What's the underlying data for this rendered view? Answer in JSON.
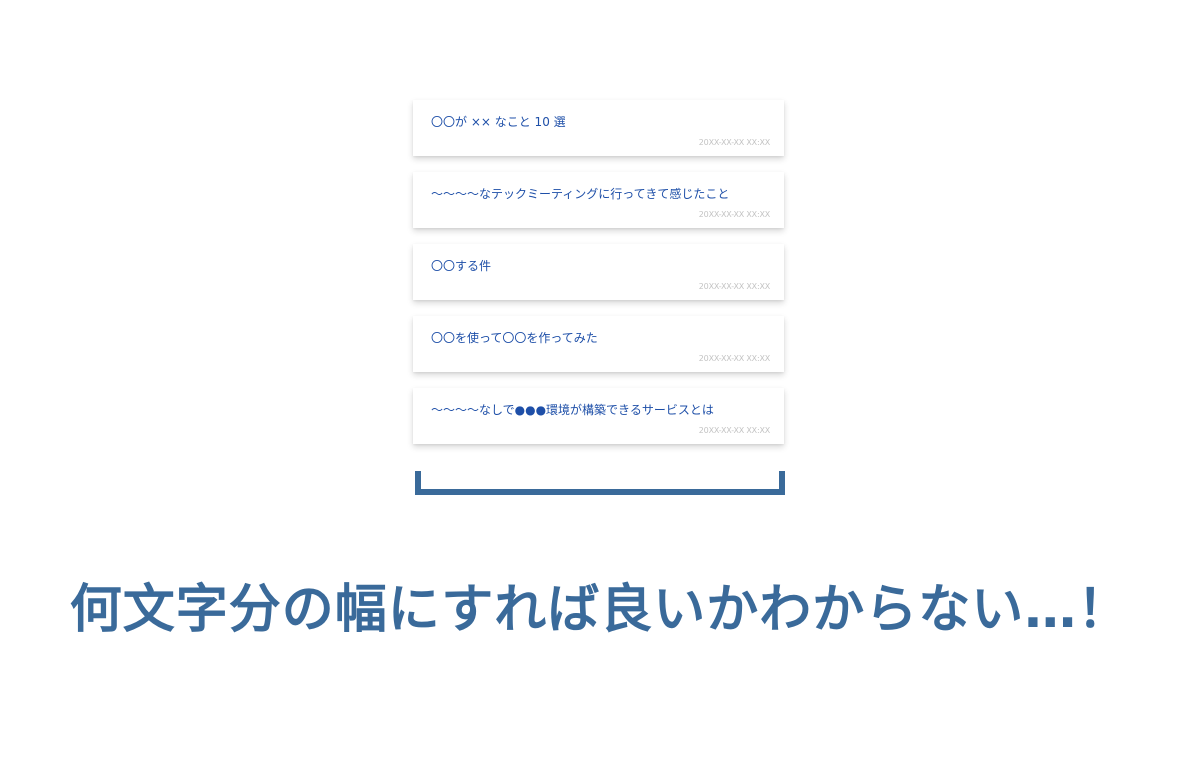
{
  "articles": [
    {
      "title": "〇〇が ×× なこと 10 選",
      "date": "20XX-XX-XX XX:XX"
    },
    {
      "title": "〜〜〜〜なテックミーティングに行ってきて感じたこと",
      "date": "20XX-XX-XX XX:XX"
    },
    {
      "title": "〇〇する件",
      "date": "20XX-XX-XX XX:XX"
    },
    {
      "title": "〇〇を使って〇〇を作ってみた",
      "date": "20XX-XX-XX XX:XX"
    },
    {
      "title": "〜〜〜〜なしで●●●環境が構築できるサービスとは",
      "date": "20XX-XX-XX XX:XX"
    }
  ],
  "caption": "何文字分の幅にすれば良いかわからない…！",
  "colors": {
    "title": "#1e4fa8",
    "date": "#c4c4c4",
    "bracket": "#3a6a9a",
    "caption": "#3a6a9a"
  }
}
